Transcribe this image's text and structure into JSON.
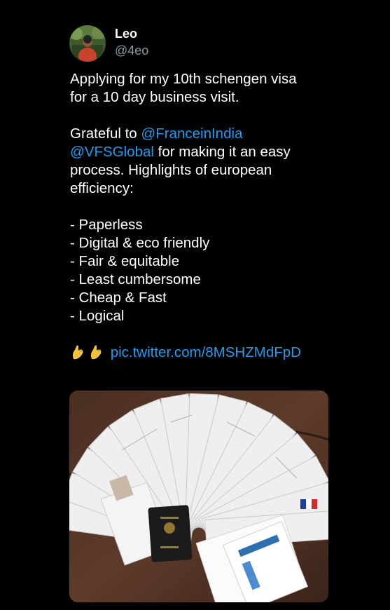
{
  "tweet": {
    "author": {
      "name": "Leo",
      "handle": "@4eo"
    },
    "text": {
      "intro_line1": "Applying for my 10th schengen visa",
      "intro_line2": "for a 10 day business visit.",
      "grateful_prefix": "Grateful to ",
      "mention_france": "@FranceinIndia",
      "mention_vfs": "@VFSGlobal",
      "grateful_suffix": " for making it an easy",
      "line_process": "process. Highlights of european",
      "line_efficiency": "efficiency:",
      "highlights": [
        "- Paperless",
        "- Digital & eco friendly",
        "- Fair & equitable",
        "- Least cumbersome",
        "- Cheap & Fast",
        "- Logical"
      ],
      "pic_link": "pic.twitter.com/8MSHZMdFpD"
    },
    "emoji": {
      "name": "pinching-hand-emoji",
      "count": 2,
      "color": "#f5c33b"
    },
    "colors": {
      "background": "#000000",
      "text": "#ffffff",
      "handle": "#8b98a5",
      "link": "#1d9bf0"
    },
    "photo": {
      "subject": "stack-of-visa-documents-with-passport"
    }
  }
}
